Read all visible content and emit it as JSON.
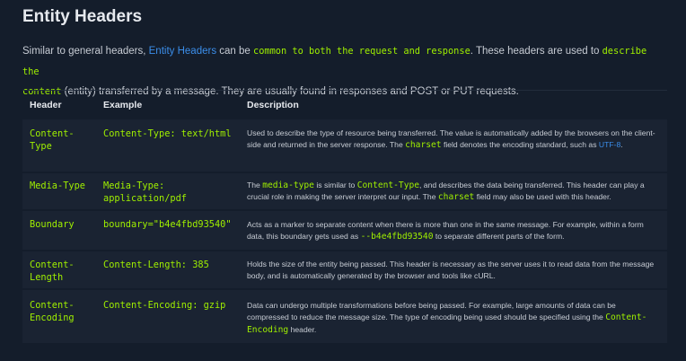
{
  "title": "Entity Headers",
  "intro": {
    "t1": "Similar to general headers, ",
    "link": "Entity Headers",
    "t2": " can be ",
    "code1": "common to both the request and response",
    "t3": ". These headers are used to ",
    "code2a": "describe the",
    "code2b": "content",
    "t4": " (entity) transferred by a message. They are usually found in responses and POST or PUT requests."
  },
  "table": {
    "columns": [
      "Header",
      "Example",
      "Description"
    ],
    "rows": [
      {
        "header": [
          "Content-",
          "Type"
        ],
        "example": [
          "Content-Type: text/html"
        ],
        "desc": {
          "a": "Used to describe the type of resource being transferred. The value is automatically added by the browsers on the client-side and returned in the server response. The ",
          "code": "charset",
          "b": " field denotes the encoding standard, such as ",
          "link": "UTF-8",
          "c": "."
        }
      },
      {
        "header": [
          "Media-Type"
        ],
        "example": [
          "Media-Type:",
          "application/pdf"
        ],
        "desc": {
          "a": "The ",
          "code1": "media-type",
          "b": " is similar to ",
          "code2": "Content-Type",
          "c": ", and describes the data being transferred. This header can play a crucial role in making the server interpret our input. The ",
          "code3": "charset",
          "d": " field may also be used with this header."
        }
      },
      {
        "header": [
          "Boundary"
        ],
        "example": [
          "boundary=\"b4e4fbd93540\""
        ],
        "desc": {
          "a": "Acts as a marker to separate content when there is more than one in the same message. For example, within a form data, this boundary gets used as ",
          "code": "--b4e4fbd93540",
          "b": " to separate different parts of the form."
        }
      },
      {
        "header": [
          "Content-",
          "Length"
        ],
        "example": [
          "Content-Length: 385"
        ],
        "desc": {
          "a": "Holds the size of the entity being passed. This header is necessary as the server uses it to read data from the message body, and is automatically generated by the browser and tools like cURL."
        }
      },
      {
        "header": [
          "Content-",
          "Encoding"
        ],
        "example": [
          "Content-Encoding: gzip"
        ],
        "desc": {
          "a": "Data can undergo multiple transformations before being passed. For example, large amounts of data can be compressed to reduce the message size. The type of encoding being used should be specified using the ",
          "code": "Content-Encoding",
          "b": " header."
        }
      }
    ]
  },
  "colors": {
    "background": "#141d2b",
    "row_background": "#1a2332",
    "code": "#9fef00",
    "link": "#3b8eea"
  }
}
